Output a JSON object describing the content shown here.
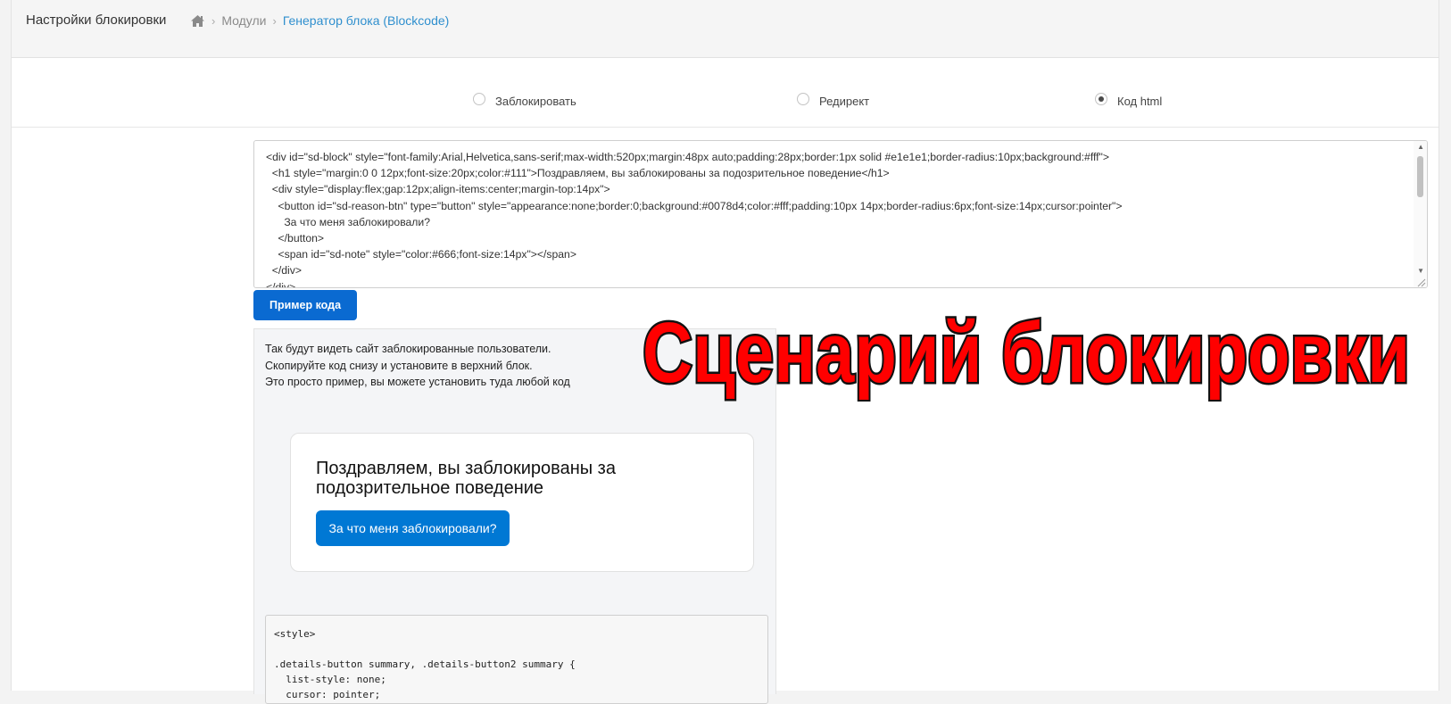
{
  "header": {
    "title": "Настройки блокировки",
    "breadcrumbs": [
      {
        "label": "Модули"
      },
      {
        "label": "Генератор блока (Blockcode)"
      }
    ]
  },
  "modes": [
    {
      "label": "Заблокировать",
      "checked": false
    },
    {
      "label": "Редирект",
      "checked": false
    },
    {
      "label": "Код html",
      "checked": true
    }
  ],
  "code_editor": {
    "lines": [
      "<div id=\"sd-block\" style=\"font-family:Arial,Helvetica,sans-serif;max-width:520px;margin:48px auto;padding:28px;border:1px solid #e1e1e1;border-radius:10px;background:#fff\">",
      "  <h1 style=\"margin:0 0 12px;font-size:20px;color:#111\">Поздравляем, вы заблокированы за подозрительное поведение</h1>",
      "  <div style=\"display:flex;gap:12px;align-items:center;margin-top:14px\">",
      "    <button id=\"sd-reason-btn\" type=\"button\" style=\"appearance:none;border:0;background:#0078d4;color:#fff;padding:10px 14px;border-radius:6px;font-size:14px;cursor:pointer\">",
      "      За что меня заблокировали?",
      "    </button>",
      "    <span id=\"sd-note\" style=\"color:#666;font-size:14px\"></span>",
      "  </div>",
      "</div>"
    ]
  },
  "example_button": {
    "label": "Пример кода"
  },
  "preview": {
    "info_lines": [
      "Так будут видеть сайт заблокированные пользователи.",
      "Скопируйте код снизу и установите в верхний блок.",
      "Это просто пример, вы можете установить туда любой код"
    ],
    "card_title": "Поздравляем, вы заблокированы за подозрительное поведение",
    "card_button": "За что меня заблокировали?",
    "css_lines": [
      "<style>",
      "",
      ".details-button summary, .details-button2 summary {",
      "  list-style: none;",
      "  cursor: pointer;"
    ]
  },
  "overlay_caption": "Сценарий блокировки",
  "colors": {
    "accent": "#2f8fce",
    "primary_button": "#0a6ad1",
    "preview_button": "#0078d4",
    "overlay_fill": "#ff0000",
    "overlay_stroke": "#111111"
  },
  "icons": {
    "home": "home-icon",
    "breadcrumb_separator": "chevron-right-icon"
  }
}
